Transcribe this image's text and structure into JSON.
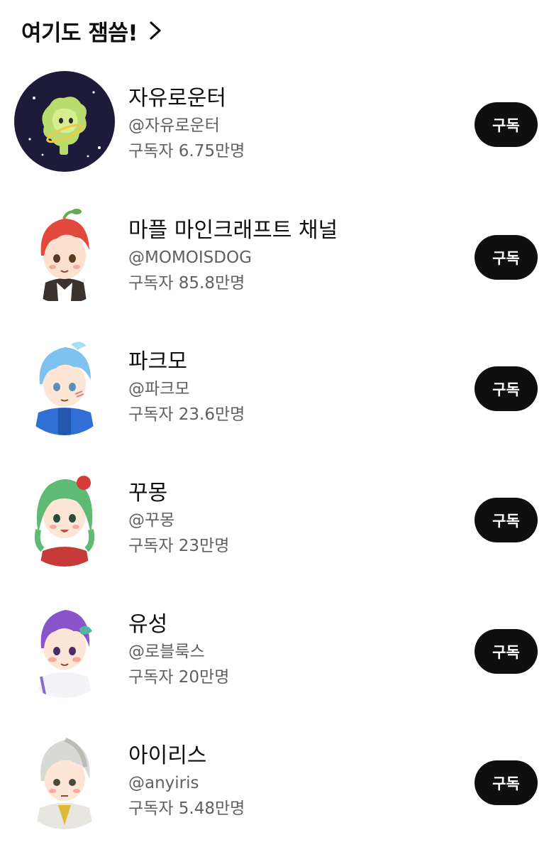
{
  "section": {
    "title": "여기도 잼씀!",
    "chevron_icon": "chevron-right-icon"
  },
  "channels": [
    {
      "name": "자유로운터",
      "handle": "@자유로운터",
      "subscribers": "구독자 6.75만명",
      "subscribe_label": "구독",
      "avatar_icon": "planet-avatar"
    },
    {
      "name": "마플 마인크래프트 채널",
      "handle": "@MOMOISDOG",
      "subscribers": "구독자 85.8만명",
      "subscribe_label": "구독",
      "avatar_icon": "red-hair-character-avatar"
    },
    {
      "name": "파크모",
      "handle": "@파크모",
      "subscribers": "구독자 23.6만명",
      "subscribe_label": "구독",
      "avatar_icon": "blue-hair-character-avatar"
    },
    {
      "name": "꾸몽",
      "handle": "@꾸몽",
      "subscribers": "구독자 23만명",
      "subscribe_label": "구독",
      "avatar_icon": "green-hair-character-avatar"
    },
    {
      "name": "유성",
      "handle": "@로블룩스",
      "subscribers": "구독자 20만명",
      "subscribe_label": "구독",
      "avatar_icon": "purple-hair-character-avatar"
    },
    {
      "name": "아이리스",
      "handle": "@anyiris",
      "subscribers": "구독자 5.48만명",
      "subscribe_label": "구독",
      "avatar_icon": "gray-hair-character-avatar"
    }
  ],
  "colors": {
    "button_bg": "#0f0f0f",
    "button_text": "#ffffff",
    "secondary_text": "#606060",
    "primary_text": "#0f0f0f"
  }
}
